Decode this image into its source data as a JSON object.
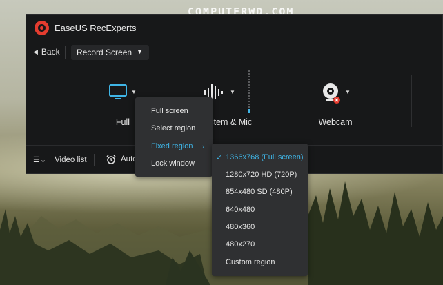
{
  "watermark": "COMPUTERWD.COM",
  "app": {
    "title": "EaseUS RecExperts"
  },
  "nav": {
    "back_label": "Back",
    "mode_selected": "Record Screen"
  },
  "sources": {
    "screen_label": "Full",
    "audio_label": "System & Mic",
    "webcam_label": "Webcam"
  },
  "bottom": {
    "video_list": "Video list",
    "auto": "Auto"
  },
  "region_menu": {
    "items": [
      "Full screen",
      "Select region",
      "Fixed region",
      "Lock window"
    ],
    "active": "Fixed region"
  },
  "fixed_region_menu": {
    "items": [
      "1366x768 (Full screen)",
      "1280x720 HD (720P)",
      "854x480 SD (480P)",
      "640x480",
      "480x360",
      "480x270",
      "Custom region"
    ],
    "selected": "1366x768 (Full screen)"
  },
  "colors": {
    "accent": "#3fb5e6",
    "brand": "#e43c2f",
    "window_bg": "#171819",
    "menu_bg": "#2f3032"
  }
}
